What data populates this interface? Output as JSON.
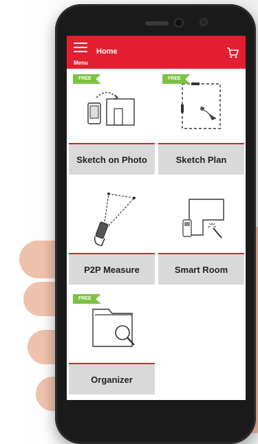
{
  "header": {
    "menu_label": "Menu",
    "home_label": "Home",
    "accent_color": "#e41e31"
  },
  "tiles": [
    {
      "label": "Sketch on Photo",
      "badge": "FREE",
      "icon": "sketch-on-photo-icon"
    },
    {
      "label": "Sketch Plan",
      "badge": "FREE",
      "icon": "sketch-plan-icon"
    },
    {
      "label": "P2P Measure",
      "icon": "p2p-measure-icon"
    },
    {
      "label": "Smart Room",
      "icon": "smart-room-icon"
    },
    {
      "label": "Organizer",
      "badge": "FREE",
      "icon": "organizer-icon"
    }
  ],
  "badge_color": "#7cc243"
}
